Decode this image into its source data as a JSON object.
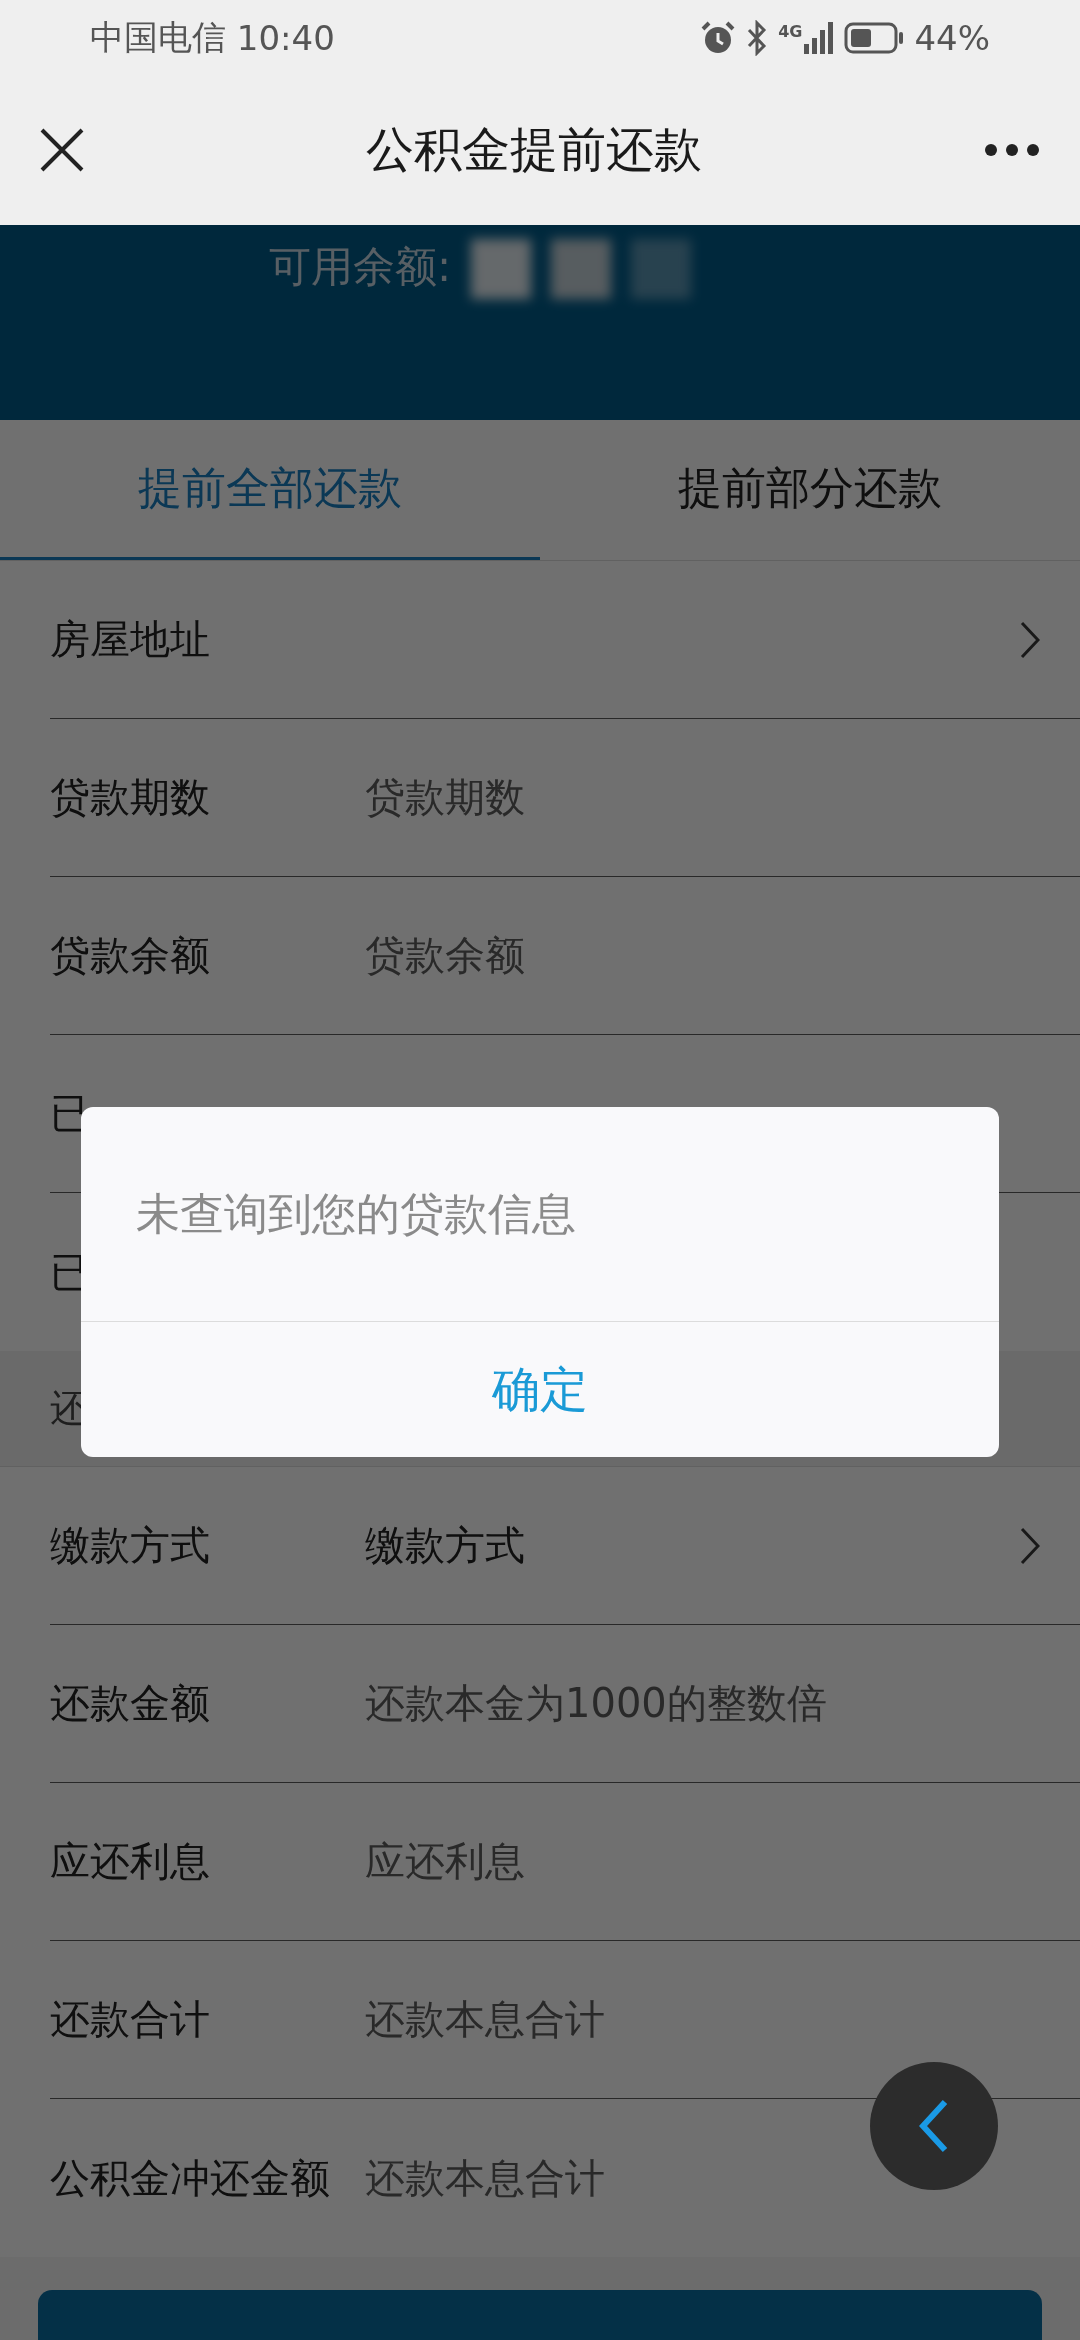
{
  "status_bar": {
    "carrier": "中国电信",
    "time": "10:40",
    "network": "4G",
    "battery": "44%"
  },
  "nav": {
    "title": "公积金提前还款"
  },
  "banner": {
    "label": "可用余额:"
  },
  "tabs": [
    {
      "label": "提前全部还款",
      "selected": true
    },
    {
      "label": "提前部分还款",
      "selected": false
    }
  ],
  "loan_rows": [
    {
      "kind": "select",
      "label": "房屋地址"
    },
    {
      "kind": "input",
      "label": "贷款期数",
      "placeholder": "贷款期数"
    },
    {
      "kind": "input",
      "label": "贷款余额",
      "placeholder": "贷款余额"
    },
    {
      "kind": "covered",
      "label": "已"
    },
    {
      "kind": "covered",
      "label": "已"
    }
  ],
  "section_label": "还",
  "repay_rows": [
    {
      "kind": "select",
      "label": "缴款方式",
      "value": "缴款方式"
    },
    {
      "kind": "input",
      "label": "还款金额",
      "placeholder": "还款本金为1000的整数倍"
    },
    {
      "kind": "input",
      "label": "应还利息",
      "placeholder": "应还利息"
    },
    {
      "kind": "input",
      "label": "还款合计",
      "placeholder": "还款本息合计"
    },
    {
      "kind": "input",
      "label": "公积金冲还金额",
      "placeholder": "还款本息合计"
    }
  ],
  "dialog": {
    "message": "未查询到您的贷款信息",
    "button": "确定"
  }
}
